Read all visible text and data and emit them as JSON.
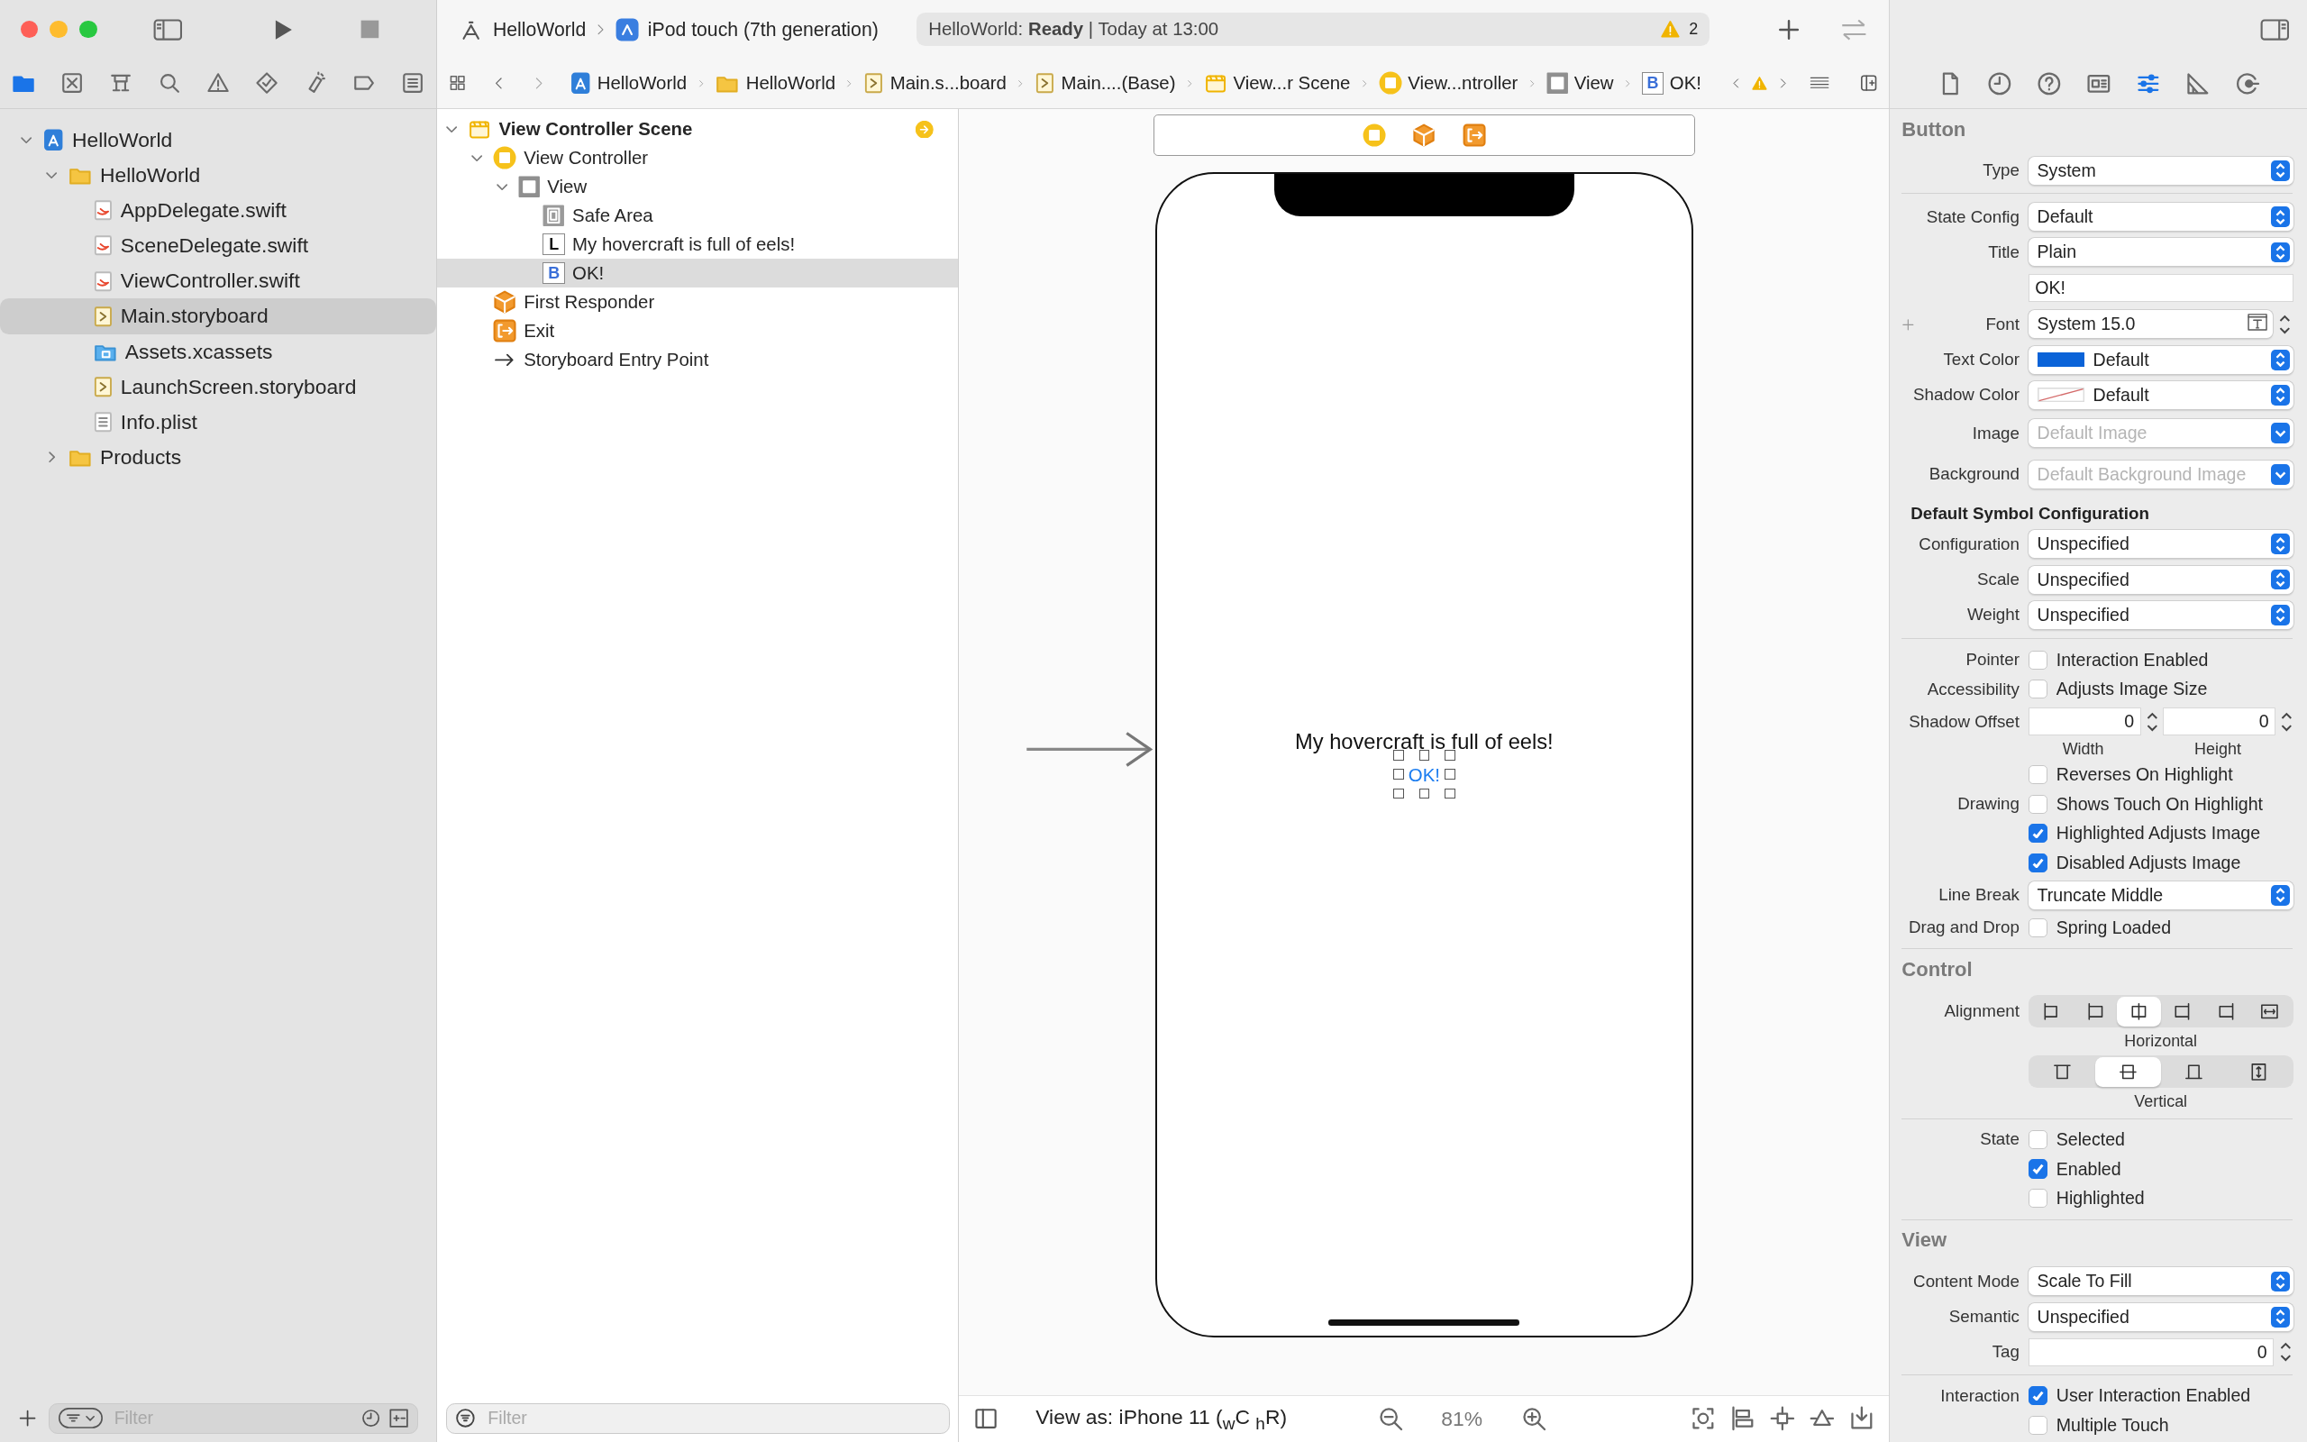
{
  "toolbar": {
    "scheme": "HelloWorld",
    "device": "iPod touch (7th generation)",
    "status": "HelloWorld: **Ready** | Today at 13:00",
    "warnings": "2"
  },
  "navigator": {
    "tabs": [
      {
        "kind": "folder",
        "selected": true
      },
      {
        "kind": "source",
        "selected": false
      },
      {
        "kind": "symbols",
        "selected": false
      },
      {
        "kind": "find",
        "selected": false
      },
      {
        "kind": "issues",
        "selected": false
      },
      {
        "kind": "tests",
        "selected": false
      },
      {
        "kind": "debug",
        "selected": false
      },
      {
        "kind": "breakpoints",
        "selected": false
      },
      {
        "kind": "reports",
        "selected": false
      }
    ],
    "tree": [
      {
        "label": "HelloWorld",
        "kind": "project",
        "selected": false,
        "expanded": true,
        "children": [
          {
            "label": "HelloWorld",
            "kind": "folder",
            "selected": false,
            "expanded": true,
            "children": [
              {
                "label": "AppDelegate.swift",
                "kind": "swift",
                "selected": false
              },
              {
                "label": "SceneDelegate.swift",
                "kind": "swift",
                "selected": false
              },
              {
                "label": "ViewController.swift",
                "kind": "swift",
                "selected": false
              },
              {
                "label": "Main.storyboard",
                "kind": "storyboard",
                "selected": true
              },
              {
                "label": "Assets.xcassets",
                "kind": "assets",
                "selected": false
              },
              {
                "label": "LaunchScreen.storyboard",
                "kind": "storyboard",
                "selected": false
              },
              {
                "label": "Info.plist",
                "kind": "plist",
                "selected": false
              }
            ]
          },
          {
            "label": "Products",
            "kind": "folder",
            "selected": false,
            "expanded": false
          }
        ]
      }
    ],
    "filter": {
      "placeholder": "Filter"
    }
  },
  "jump_bar": [
    {
      "label": "HelloWorld",
      "kind": "project"
    },
    {
      "label": "HelloWorld",
      "kind": "folder"
    },
    {
      "label": "Main.s...board",
      "kind": "storyboard"
    },
    {
      "label": "Main....(Base)",
      "kind": "storyboard"
    },
    {
      "label": "View...r Scene",
      "kind": "scene"
    },
    {
      "label": "View...ntroller",
      "kind": "controller"
    },
    {
      "label": "View",
      "kind": "view"
    },
    {
      "label": "OK!",
      "kind": "button",
      "badge": "B"
    }
  ],
  "outline": {
    "tree": [
      {
        "label": "View Controller Scene",
        "kind": "scene",
        "selected": false,
        "expanded": true,
        "children": [
          {
            "label": "View Controller",
            "kind": "controller",
            "selected": false,
            "expanded": true,
            "children": [
              {
                "label": "View",
                "kind": "view",
                "selected": false,
                "expanded": true,
                "children": [
                  {
                    "label": "Safe Area",
                    "kind": "safe_area",
                    "selected": false
                  },
                  {
                    "label": "My hovercraft is full of eels!",
                    "kind": "label",
                    "badge": "L",
                    "selected": false
                  },
                  {
                    "label": "OK!",
                    "kind": "button",
                    "badge": "B",
                    "selected": true
                  }
                ]
              }
            ]
          },
          {
            "label": "First Responder",
            "kind": "responder",
            "selected": false
          },
          {
            "label": "Exit",
            "kind": "exit",
            "selected": false
          },
          {
            "label": "Storyboard Entry Point",
            "kind": "entry",
            "selected": false
          }
        ]
      }
    ],
    "filter": {
      "placeholder": "Filter"
    }
  },
  "canvas": {
    "label": "My hovercraft is full of eels!",
    "button": "OK!",
    "view_as": "View as: iPhone 11 ($_{w}$C $_{h}$R)",
    "zoom": "81%"
  },
  "inspector": {
    "tabs": [
      {
        "kind": "file",
        "selected": false
      },
      {
        "kind": "history",
        "selected": false
      },
      {
        "kind": "help",
        "selected": false
      },
      {
        "kind": "identity",
        "selected": false
      },
      {
        "kind": "attributes",
        "selected": true
      },
      {
        "kind": "size",
        "selected": false
      },
      {
        "kind": "connections",
        "selected": false
      }
    ],
    "sections": [
      {
        "title": "Button",
        "groups": [
          [
            {
              "kind": "popup",
              "label": "Type",
              "value": "System"
            }
          ],
          [
            {
              "kind": "popup",
              "label": "State Config",
              "value": "Default"
            },
            {
              "kind": "popup",
              "label": "Title",
              "value": "Plain"
            },
            {
              "kind": "text",
              "value": "OK!"
            },
            {
              "kind": "font",
              "label": "Font",
              "value": "System 15.0"
            },
            {
              "kind": "color",
              "label": "Text Color",
              "value": "Default",
              "color": "#0a63d8"
            },
            {
              "kind": "color",
              "label": "Shadow Color",
              "value": "Default"
            },
            {
              "kind": "popup",
              "label": "Image",
              "placeholder": "Default Image"
            },
            {
              "kind": "popup",
              "label": "Background",
              "placeholder": "Default Background Image"
            },
            {
              "kind": "subheading",
              "label": "Default Symbol Configuration"
            },
            {
              "kind": "popup",
              "label": "Configuration",
              "value": "Unspecified"
            },
            {
              "kind": "popup",
              "label": "Scale",
              "value": "Unspecified"
            },
            {
              "kind": "popup",
              "label": "Weight",
              "value": "Unspecified"
            }
          ],
          [
            {
              "kind": "checkbox",
              "label": "Pointer",
              "text": "Interaction Enabled",
              "checked": false
            },
            {
              "kind": "checkbox",
              "label": "Accessibility",
              "text": "Adjusts Image Size",
              "checked": false
            },
            {
              "kind": "offset",
              "label": "Shadow Offset",
              "fields": [
                {
                  "value": "0",
                  "caption": "Width"
                },
                {
                  "value": "0",
                  "caption": "Height"
                }
              ]
            },
            {
              "kind": "checkbox",
              "text": "Reverses On Highlight",
              "checked": false
            },
            {
              "kind": "checkbox",
              "label": "Drawing",
              "text": "Shows Touch On Highlight",
              "checked": false
            },
            {
              "kind": "checkbox",
              "text": "Highlighted Adjusts Image",
              "checked": true
            },
            {
              "kind": "checkbox",
              "text": "Disabled Adjusts Image",
              "checked": true
            },
            {
              "kind": "popup",
              "label": "Line Break",
              "value": "Truncate Middle"
            },
            {
              "kind": "checkbox",
              "label": "Drag and Drop",
              "text": "Spring Loaded",
              "checked": false
            }
          ]
        ]
      },
      {
        "title": "Control",
        "groups": [
          [
            {
              "kind": "segmented",
              "label": "Alignment",
              "caption": "Horizontal",
              "segments": [
                {
                  "kind": "left",
                  "selected": false
                },
                {
                  "kind": "leading",
                  "selected": false
                },
                {
                  "kind": "center",
                  "selected": true
                },
                {
                  "kind": "trailing",
                  "selected": false
                },
                {
                  "kind": "right",
                  "selected": false
                },
                {
                  "kind": "fill",
                  "selected": false
                }
              ]
            },
            {
              "kind": "segmented",
              "caption": "Vertical",
              "segments": [
                {
                  "kind": "top",
                  "selected": false
                },
                {
                  "kind": "middle",
                  "selected": true
                },
                {
                  "kind": "bottom",
                  "selected": false
                },
                {
                  "kind": "stretch",
                  "selected": false
                }
              ]
            }
          ],
          [
            {
              "kind": "checkbox",
              "label": "State",
              "text": "Selected",
              "checked": false
            },
            {
              "kind": "checkbox",
              "text": "Enabled",
              "checked": true
            },
            {
              "kind": "checkbox",
              "text": "Highlighted",
              "checked": false
            }
          ]
        ]
      },
      {
        "title": "View",
        "groups": [
          [
            {
              "kind": "popup",
              "label": "Content Mode",
              "value": "Scale To Fill"
            },
            {
              "kind": "popup",
              "label": "Semantic",
              "value": "Unspecified"
            },
            {
              "kind": "number",
              "label": "Tag",
              "value": "0"
            }
          ],
          [
            {
              "kind": "checkbox",
              "label": "Interaction",
              "text": "User Interaction Enabled",
              "checked": true
            },
            {
              "kind": "checkbox",
              "text": "Multiple Touch",
              "checked": false
            }
          ]
        ]
      }
    ]
  }
}
